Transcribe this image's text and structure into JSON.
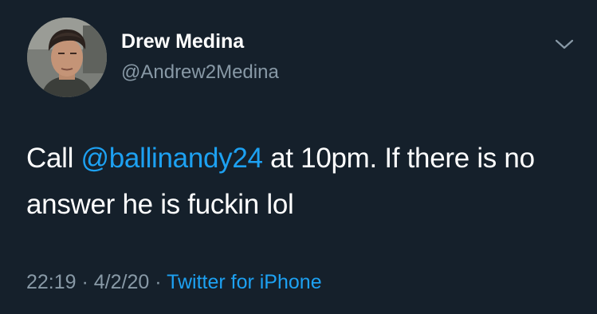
{
  "user": {
    "display_name": "Drew Medina",
    "handle": "@Andrew2Medina"
  },
  "tweet": {
    "text_before": "Call ",
    "mention": "@ballinandy24",
    "text_after": " at 10pm. If there is no answer he is fuckin lol"
  },
  "meta": {
    "time": "22:19",
    "sep1": " · ",
    "date": "4/2/20",
    "sep2": " · ",
    "source": "Twitter for iPhone"
  },
  "icons": {
    "more": "chevron-down-icon",
    "avatar": "profile-photo"
  },
  "colors": {
    "background": "#15202b",
    "primary_text": "#ffffff",
    "secondary_text": "#8899a6",
    "link": "#1da1f2"
  }
}
